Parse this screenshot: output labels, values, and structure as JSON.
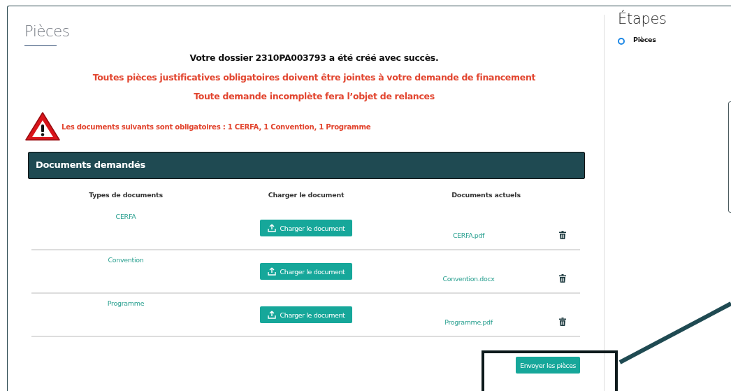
{
  "main": {
    "title": "Pièces",
    "success_message": "Votre dossier 2310PA003793 a été créé avec succès.",
    "warnings": [
      "Toutes pièces justificatives obligatoires doivent être jointes à votre demande de financement",
      "Toute demande incomplète fera l’objet de relances"
    ],
    "required_notice": "Les documents suivants sont obligatoires : 1 CERFA, 1 Convention, 1 Programme",
    "documents": {
      "title": "Documents demandés",
      "columns": [
        "Types de documents",
        "Charger le document",
        "Documents actuels"
      ],
      "rows": [
        {
          "type": "CERFA",
          "upload_button": "Charger le document",
          "file": "CERFA.pdf"
        },
        {
          "type": "Convention",
          "upload_button": "Charger le document",
          "file": "Convention.docx"
        },
        {
          "type": "Programme",
          "upload_button": "Charger le document",
          "file": "Programme.pdf"
        }
      ]
    },
    "submit_button": "Envoyer les pièces"
  },
  "sidebar": {
    "title": "Étapes",
    "steps": [
      {
        "label": "Pièces",
        "selected": true
      }
    ]
  }
}
